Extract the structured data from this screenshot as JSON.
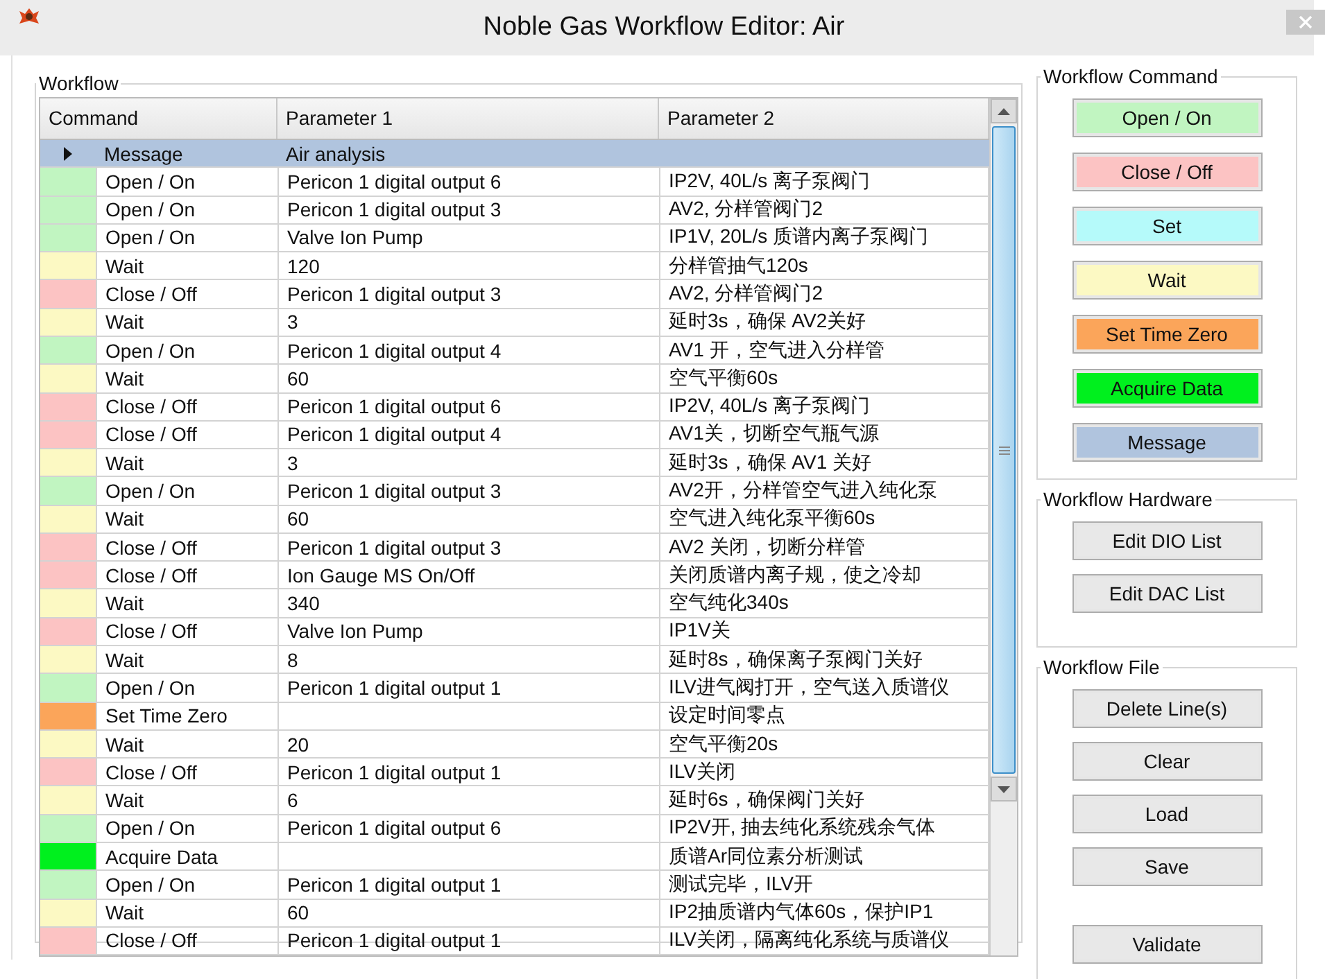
{
  "window": {
    "title": "Noble Gas Workflow Editor: Air"
  },
  "workflow": {
    "title": "Workflow",
    "columns": [
      "Command",
      "Parameter 1",
      "Parameter 2"
    ],
    "rows": [
      {
        "command": "Message",
        "parameter_1": "Air analysis",
        "parameter_2": "",
        "color": "#b0c4de",
        "selected": true
      },
      {
        "command": "Open / On",
        "parameter_1": "Pericon 1 digital output 6",
        "parameter_2": "IP2V, 40L/s 离子泵阀门",
        "color": "#c1f5c1",
        "selected": false
      },
      {
        "command": "Open / On",
        "parameter_1": "Pericon 1 digital output 3",
        "parameter_2": "AV2, 分样管阀门2",
        "color": "#c1f5c1",
        "selected": false
      },
      {
        "command": "Open / On",
        "parameter_1": "Valve Ion Pump",
        "parameter_2": "IP1V, 20L/s 质谱内离子泵阀门",
        "color": "#c1f5c1",
        "selected": false
      },
      {
        "command": "Wait",
        "parameter_1": "120",
        "parameter_2": "分样管抽气120s",
        "color": "#fcf9c3",
        "selected": false
      },
      {
        "command": "Close / Off",
        "parameter_1": "Pericon 1 digital output 3",
        "parameter_2": "AV2, 分样管阀门2",
        "color": "#fcc3c3",
        "selected": false
      },
      {
        "command": "Wait",
        "parameter_1": "3",
        "parameter_2": "延时3s，确保 AV2关好",
        "color": "#fcf9c3",
        "selected": false
      },
      {
        "command": "Open / On",
        "parameter_1": "Pericon 1 digital output 4",
        "parameter_2": "AV1 开，空气进入分样管",
        "color": "#c1f5c1",
        "selected": false
      },
      {
        "command": "Wait",
        "parameter_1": "60",
        "parameter_2": "空气平衡60s",
        "color": "#fcf9c3",
        "selected": false
      },
      {
        "command": "Close / Off",
        "parameter_1": "Pericon 1 digital output 6",
        "parameter_2": "IP2V, 40L/s 离子泵阀门",
        "color": "#fcc3c3",
        "selected": false
      },
      {
        "command": "Close / Off",
        "parameter_1": "Pericon 1 digital output 4",
        "parameter_2": "AV1关，切断空气瓶气源",
        "color": "#fcc3c3",
        "selected": false
      },
      {
        "command": "Wait",
        "parameter_1": "3",
        "parameter_2": "延时3s，确保 AV1 关好",
        "color": "#fcf9c3",
        "selected": false
      },
      {
        "command": "Open / On",
        "parameter_1": "Pericon 1 digital output 3",
        "parameter_2": "AV2开，分样管空气进入纯化泵",
        "color": "#c1f5c1",
        "selected": false
      },
      {
        "command": "Wait",
        "parameter_1": "60",
        "parameter_2": "空气进入纯化泵平衡60s",
        "color": "#fcf9c3",
        "selected": false
      },
      {
        "command": "Close / Off",
        "parameter_1": "Pericon 1 digital output 3",
        "parameter_2": "AV2 关闭，切断分样管",
        "color": "#fcc3c3",
        "selected": false
      },
      {
        "command": "Close / Off",
        "parameter_1": "Ion Gauge MS On/Off",
        "parameter_2": "关闭质谱内离子规，使之冷却",
        "color": "#fcc3c3",
        "selected": false
      },
      {
        "command": "Wait",
        "parameter_1": "340",
        "parameter_2": "空气纯化340s",
        "color": "#fcf9c3",
        "selected": false
      },
      {
        "command": "Close / Off",
        "parameter_1": "Valve Ion Pump",
        "parameter_2": "IP1V关",
        "color": "#fcc3c3",
        "selected": false
      },
      {
        "command": "Wait",
        "parameter_1": "8",
        "parameter_2": "延时8s，确保离子泵阀门关好",
        "color": "#fcf9c3",
        "selected": false
      },
      {
        "command": "Open / On",
        "parameter_1": "Pericon 1 digital output 1",
        "parameter_2": "ILV进气阀打开，空气送入质谱仪",
        "color": "#c1f5c1",
        "selected": false
      },
      {
        "command": "Set Time Zero",
        "parameter_1": "",
        "parameter_2": "设定时间零点",
        "color": "#fba55a",
        "selected": false
      },
      {
        "command": "Wait",
        "parameter_1": "20",
        "parameter_2": "空气平衡20s",
        "color": "#fcf9c3",
        "selected": false
      },
      {
        "command": "Close / Off",
        "parameter_1": "Pericon 1 digital output 1",
        "parameter_2": "ILV关闭",
        "color": "#fcc3c3",
        "selected": false
      },
      {
        "command": "Wait",
        "parameter_1": "6",
        "parameter_2": "延时6s，确保阀门关好",
        "color": "#fcf9c3",
        "selected": false
      },
      {
        "command": "Open / On",
        "parameter_1": "Pericon 1 digital output 6",
        "parameter_2": "IP2V开, 抽去纯化系统残余气体",
        "color": "#c1f5c1",
        "selected": false
      },
      {
        "command": "Acquire Data",
        "parameter_1": "",
        "parameter_2": "质谱Ar同位素分析测试",
        "color": "#00f01e",
        "selected": false
      },
      {
        "command": "Open / On",
        "parameter_1": "Pericon 1 digital output 1",
        "parameter_2": "测试完毕，ILV开",
        "color": "#c1f5c1",
        "selected": false
      },
      {
        "command": "Wait",
        "parameter_1": "60",
        "parameter_2": "IP2抽质谱内气体60s，保护IP1",
        "color": "#fcf9c3",
        "selected": false
      },
      {
        "command": "Close / Off",
        "parameter_1": "Pericon 1 digital output 1",
        "parameter_2": "ILV关闭，隔离纯化系统与质谱仪",
        "color": "#fcc3c3",
        "selected": false
      }
    ]
  },
  "workflow_command": {
    "title": "Workflow Command",
    "buttons": [
      {
        "label": "Open / On",
        "color": "#c1f5c1"
      },
      {
        "label": "Close / Off",
        "color": "#fcc3c3"
      },
      {
        "label": "Set",
        "color": "#b5fafa"
      },
      {
        "label": "Wait",
        "color": "#fcf9c3"
      },
      {
        "label": "Set Time Zero",
        "color": "#fba55a"
      },
      {
        "label": "Acquire Data",
        "color": "#00f01e"
      },
      {
        "label": "Message",
        "color": "#b0c4de"
      }
    ]
  },
  "workflow_hardware": {
    "title": "Workflow Hardware",
    "buttons": [
      "Edit DIO List",
      "Edit DAC List"
    ]
  },
  "workflow_file": {
    "title": "Workflow File",
    "buttons": [
      "Delete Line(s)",
      "Clear",
      "Load",
      "Save",
      "Validate"
    ]
  }
}
